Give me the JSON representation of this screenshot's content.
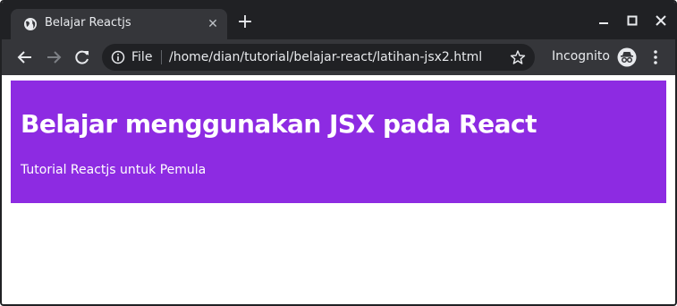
{
  "tab": {
    "title": "Belajar Reactjs",
    "close": "✕",
    "favicon": "globe-icon"
  },
  "new_tab": "+",
  "window_controls": {
    "minimize": "minimize-icon",
    "maximize": "maximize-icon",
    "close": "close-icon"
  },
  "toolbar": {
    "scheme": "File",
    "url": "/home/dian/tutorial/belajar-react/latihan-jsx2.html",
    "incognito_label": "Incognito"
  },
  "page": {
    "heading": "Belajar menggunakan JSX pada React",
    "subtitle": "Tutorial Reactjs untuk Pemula"
  },
  "colors": {
    "titlebar": "#202124",
    "toolbar": "#35363a",
    "hero_bg": "#8d2be2",
    "hero_text": "#ffffff"
  }
}
